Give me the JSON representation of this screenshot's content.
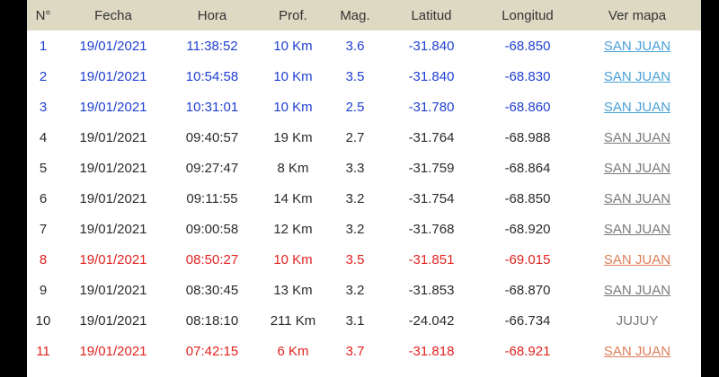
{
  "headers": [
    "N°",
    "Fecha",
    "Hora",
    "Prof.",
    "Mag.",
    "Latitud",
    "Longitud",
    "Ver mapa"
  ],
  "colors": {
    "blue": "#1f3fd0",
    "red": "#e0231f",
    "dark": "#2b2b2b",
    "header_bg": "#ddd9c3"
  },
  "rows": [
    {
      "n": "1",
      "fecha": "19/01/2021",
      "hora": "11:38:52",
      "prof": "10 Km",
      "mag": "3.6",
      "lat": "-31.840",
      "lon": "-68.850",
      "mapa": "SAN JUAN",
      "color": "blue",
      "link": true
    },
    {
      "n": "2",
      "fecha": "19/01/2021",
      "hora": "10:54:58",
      "prof": "10 Km",
      "mag": "3.5",
      "lat": "-31.840",
      "lon": "-68.830",
      "mapa": "SAN JUAN",
      "color": "blue",
      "link": true
    },
    {
      "n": "3",
      "fecha": "19/01/2021",
      "hora": "10:31:01",
      "prof": "10 Km",
      "mag": "2.5",
      "lat": "-31.780",
      "lon": "-68.860",
      "mapa": "SAN JUAN",
      "color": "blue",
      "link": true
    },
    {
      "n": "4",
      "fecha": "19/01/2021",
      "hora": "09:40:57",
      "prof": "19 Km",
      "mag": "2.7",
      "lat": "-31.764",
      "lon": "-68.988",
      "mapa": "SAN JUAN",
      "color": "dark",
      "link": true
    },
    {
      "n": "5",
      "fecha": "19/01/2021",
      "hora": "09:27:47",
      "prof": "8 Km",
      "mag": "3.3",
      "lat": "-31.759",
      "lon": "-68.864",
      "mapa": "SAN JUAN",
      "color": "dark",
      "link": true
    },
    {
      "n": "6",
      "fecha": "19/01/2021",
      "hora": "09:11:55",
      "prof": "14 Km",
      "mag": "3.2",
      "lat": "-31.754",
      "lon": "-68.850",
      "mapa": "SAN JUAN",
      "color": "dark",
      "link": true
    },
    {
      "n": "7",
      "fecha": "19/01/2021",
      "hora": "09:00:58",
      "prof": "12 Km",
      "mag": "3.2",
      "lat": "-31.768",
      "lon": "-68.920",
      "mapa": "SAN JUAN",
      "color": "dark",
      "link": true
    },
    {
      "n": "8",
      "fecha": "19/01/2021",
      "hora": "08:50:27",
      "prof": "10 Km",
      "mag": "3.5",
      "lat": "-31.851",
      "lon": "-69.015",
      "mapa": "SAN JUAN",
      "color": "red",
      "link": true
    },
    {
      "n": "9",
      "fecha": "19/01/2021",
      "hora": "08:30:45",
      "prof": "13 Km",
      "mag": "3.2",
      "lat": "-31.853",
      "lon": "-68.870",
      "mapa": "SAN JUAN",
      "color": "dark",
      "link": true
    },
    {
      "n": "10",
      "fecha": "19/01/2021",
      "hora": "08:18:10",
      "prof": "211 Km",
      "mag": "3.1",
      "lat": "-24.042",
      "lon": "-66.734",
      "mapa": "JUJUY",
      "color": "dark",
      "link": false
    },
    {
      "n": "11",
      "fecha": "19/01/2021",
      "hora": "07:42:15",
      "prof": "6 Km",
      "mag": "3.7",
      "lat": "-31.818",
      "lon": "-68.921",
      "mapa": "SAN JUAN",
      "color": "red",
      "link": true
    }
  ]
}
